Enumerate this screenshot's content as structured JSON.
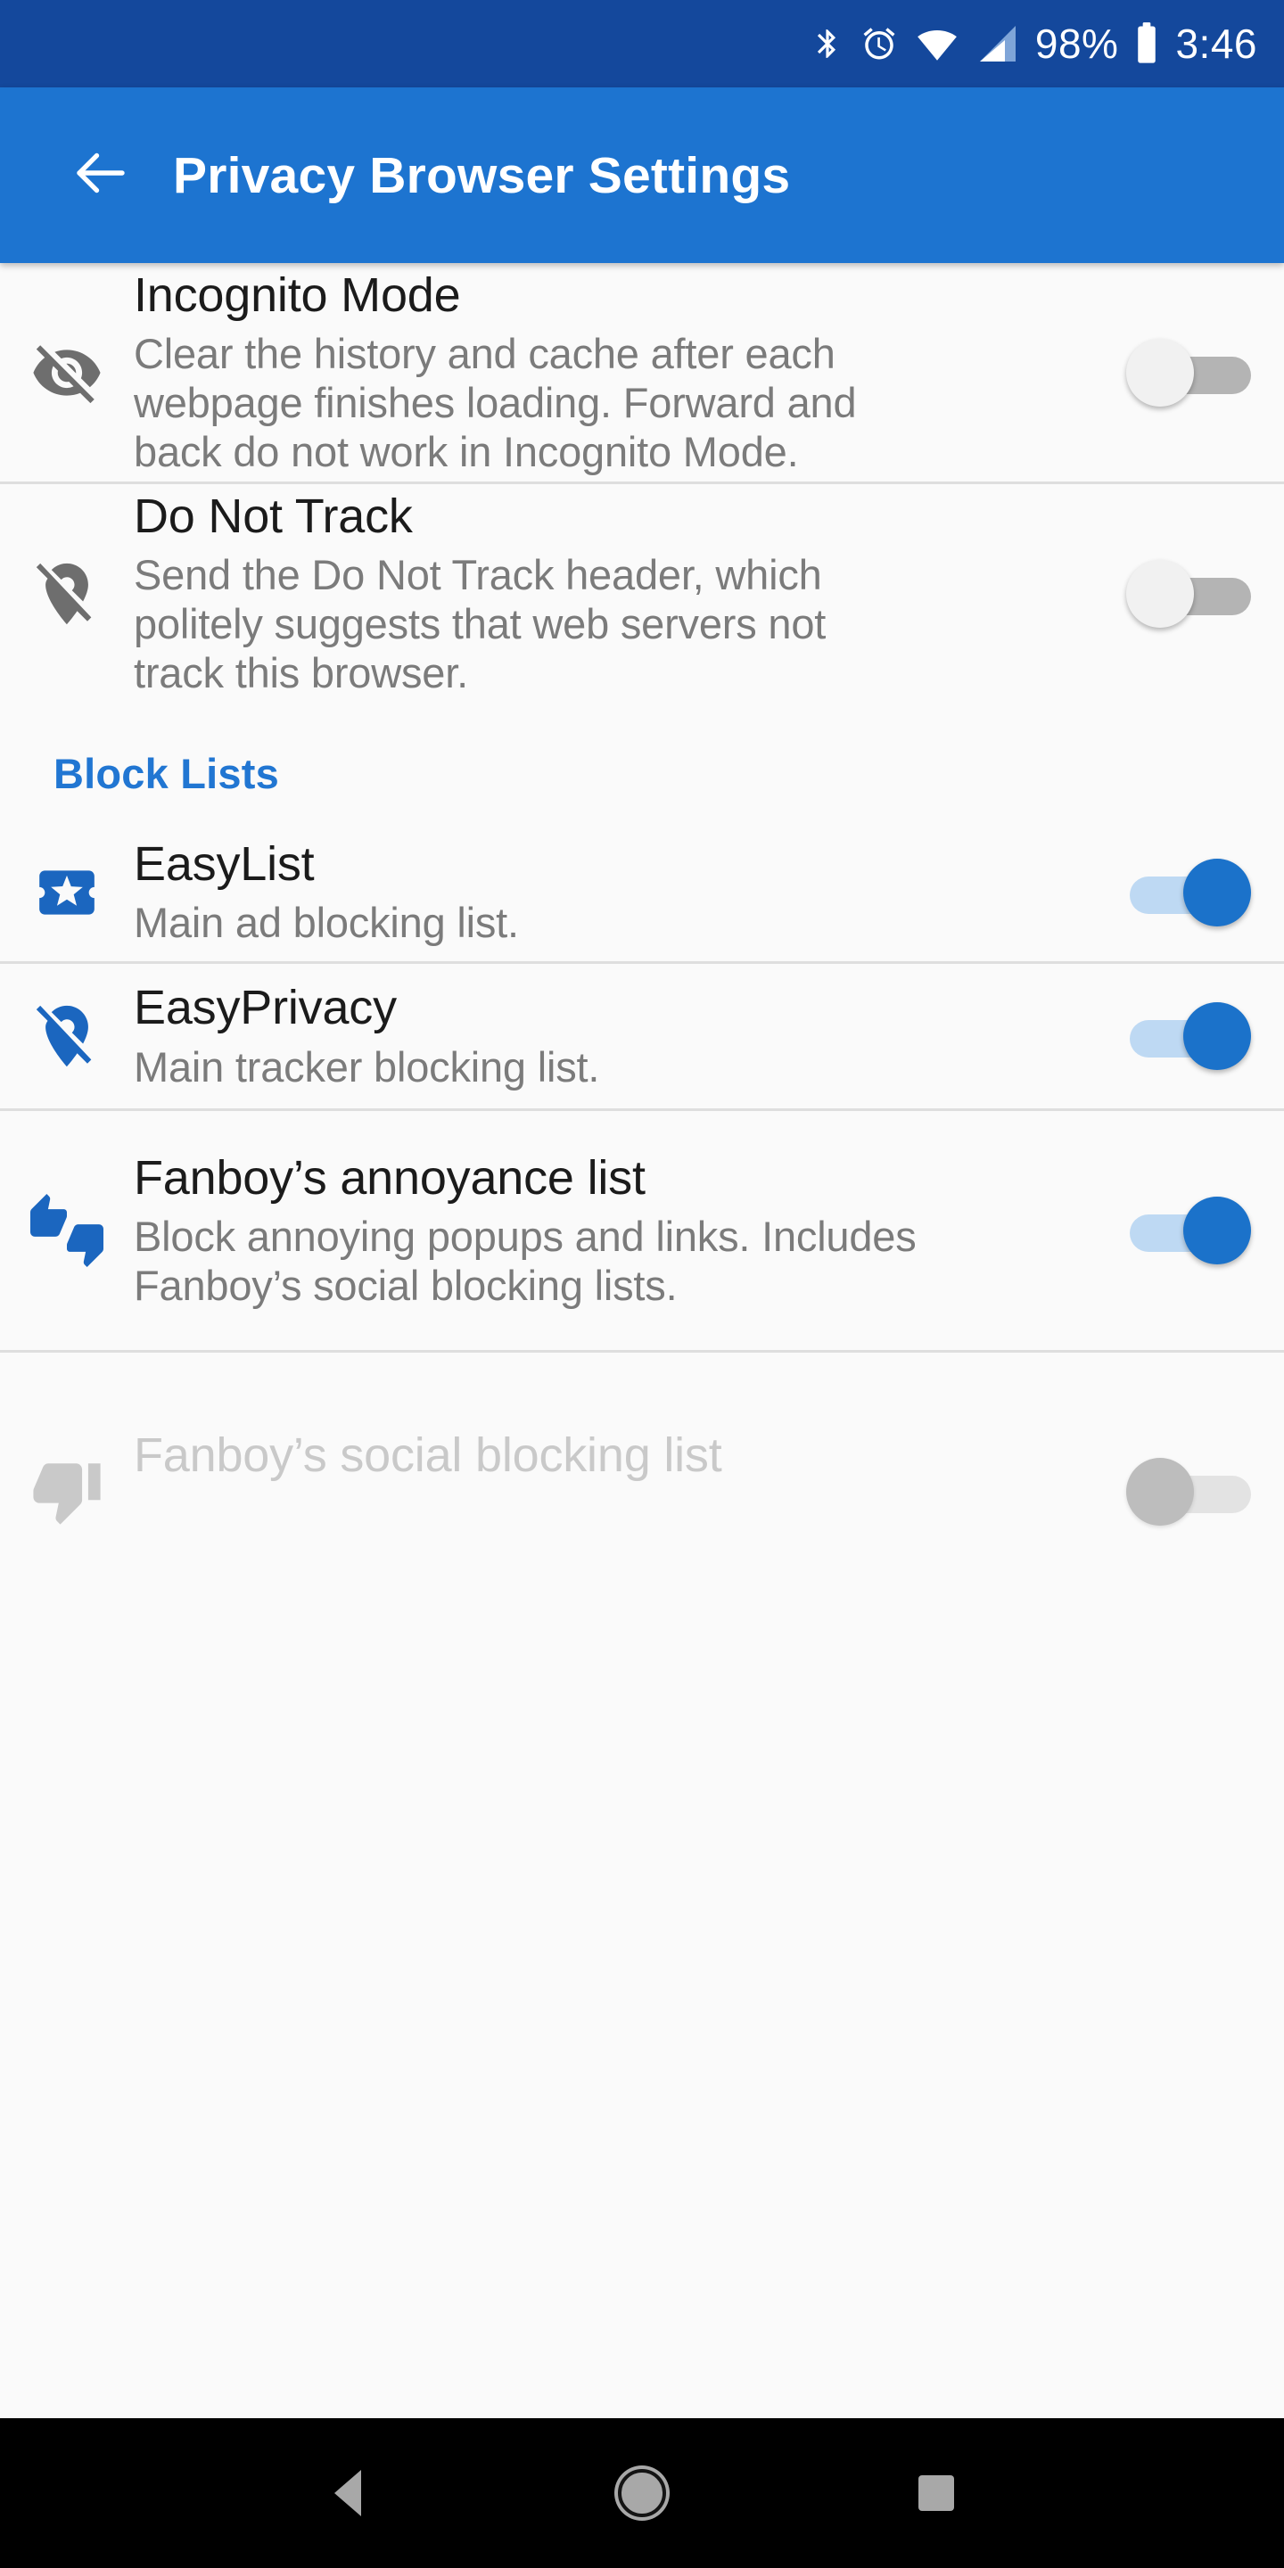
{
  "status_bar": {
    "icons": [
      "bluetooth-icon",
      "alarm-icon",
      "wifi-icon",
      "cellular-signal-icon",
      "battery-icon"
    ],
    "battery_percent": "98%",
    "time": "3:46",
    "background": "#14489c"
  },
  "app_bar": {
    "back_label": "back-arrow",
    "title": "Privacy Browser Settings",
    "background": "#1d74d0"
  },
  "settings": {
    "items": [
      {
        "key": "incognito_mode",
        "icon": "visibility-off-icon",
        "icon_color": "#6e6e6e",
        "title": "Incognito Mode",
        "summary": "Clear the history and cache after each webpage finishes loading. Forward and back do not work in Incognito Mode.",
        "toggle_state": "off"
      },
      {
        "key": "do_not_track",
        "icon": "location-off-icon",
        "icon_color": "#6e6e6e",
        "title": "Do Not Track",
        "summary": "Send the Do Not Track header, which politely suggests that web servers not track this browser.",
        "toggle_state": "off"
      }
    ]
  },
  "block_lists": {
    "header": "Block Lists",
    "header_color": "#2176d2",
    "items": [
      {
        "key": "easylist",
        "icon": "ticket-star-icon",
        "icon_color": "#1b66bf",
        "title": "EasyList",
        "summary": "Main ad blocking list.",
        "toggle_state": "on"
      },
      {
        "key": "easyprivacy",
        "icon": "location-off-icon",
        "icon_color": "#1b66bf",
        "title": "EasyPrivacy",
        "summary": "Main tracker blocking list.",
        "toggle_state": "on"
      },
      {
        "key": "fanboys_annoyance",
        "icon": "thumbs-up-down-icon",
        "icon_color": "#1b66bf",
        "title": "Fanboy’s annoyance list",
        "summary": "Block annoying popups and links. Includes Fanboy’s social blocking lists.",
        "toggle_state": "on"
      },
      {
        "key": "fanboys_social",
        "icon": "thumb-down-icon",
        "icon_color": "#c9c9c9",
        "title": "Fanboy’s social blocking list",
        "summary": "",
        "toggle_state": "disabled"
      }
    ]
  },
  "nav_bar": {
    "back": "back-triangle-icon",
    "home": "home-circle-icon",
    "recents": "recents-square-icon",
    "background": "#000000"
  },
  "colors": {
    "accent": "#1d74d0",
    "status_bar": "#14489c",
    "page_background": "#fafafa",
    "divider": "#dedede",
    "toggle_on_thumb": "#1b72ca",
    "toggle_on_track": "#bed9f3",
    "toggle_off_thumb": "#f1f1f1",
    "toggle_off_track": "#b4b4b4"
  }
}
